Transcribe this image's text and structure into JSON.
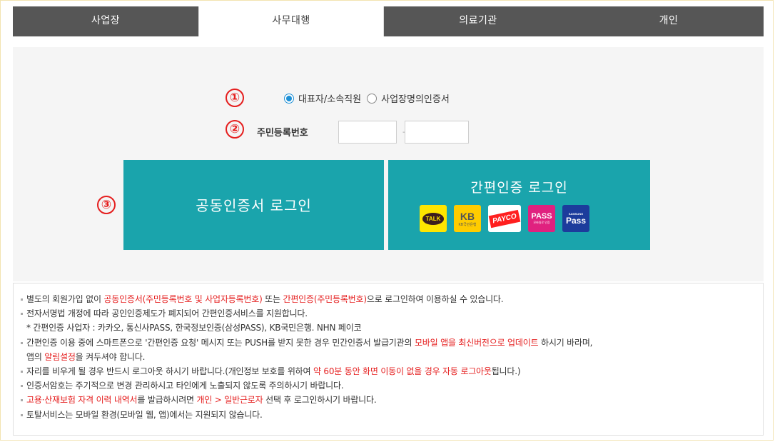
{
  "tabs": [
    {
      "label": "사업장",
      "active": false
    },
    {
      "label": "사무대행",
      "active": true
    },
    {
      "label": "의료기관",
      "active": false
    },
    {
      "label": "개인",
      "active": false
    }
  ],
  "steps": {
    "one": "①",
    "two": "②",
    "three": "③"
  },
  "auth_type": {
    "options": [
      {
        "label": "대표자/소속직원",
        "checked": true
      },
      {
        "label": "사업장명의인증서",
        "checked": false
      }
    ]
  },
  "rrn": {
    "label": "주민등록번호",
    "separator": "-",
    "first_value": "",
    "second_value": ""
  },
  "buttons": {
    "cert_login": "공동인증서 로그인",
    "simple_login": "간편인증 로그인"
  },
  "providers": [
    {
      "name": "kakao-talk",
      "label": "TALK"
    },
    {
      "name": "kb-bank",
      "label": "KB",
      "sub": "KB국민은행"
    },
    {
      "name": "payco",
      "label": "PAYCO"
    },
    {
      "name": "pass",
      "label": "PASS",
      "sub": "모바일로 인증"
    },
    {
      "name": "samsung-pass",
      "label": "Pass",
      "sub": "SAMSUNG"
    }
  ],
  "colors": {
    "accent": "#1aa4ac",
    "tab_bar": "#565656",
    "highlight": "#e51e1e",
    "radio": "#1e90d6"
  },
  "notice": {
    "l1_a": "별도의 회원가입 없이 ",
    "l1_b": "공동인증서(주민등록번호 및 사업자등록번호)",
    "l1_c": " 또는 ",
    "l1_d": "간편인증(주민등록번호)",
    "l1_e": "으로 로그인하여 이용하실 수 있습니다.",
    "l2": "전자서명법 개정에 따라 공인인증제도가 폐지되어 간편인증서비스를 지원합니다.",
    "l3": "* 간편인증 사업자 : 카카오, 통신사PASS, 한국정보인증(삼성PASS), KB국민은행. NHN 페이코",
    "l4_a": "간편인증 이용 중에 스마트폰으로 '간편인증 요청' 메시지 또는 PUSH를 받지 못한 경우 민간인증서 발급기관의 ",
    "l4_b": "모바일 앱을 최신버전으로 업데이트",
    "l4_c": " 하시기 바라며,",
    "l5_a": "앱의 ",
    "l5_b": "알림설정",
    "l5_c": "을 켜두셔야 합니다.",
    "l6_a": "자리를 비우게 될 경우 반드시 로그아웃 하시기 바랍니다.(개인정보 보호를 위하여 ",
    "l6_b": "약 60분 동안 화면 이동이 없을 경우 자동 로그아웃",
    "l6_c": "됩니다.)",
    "l7": "인증서암호는 주기적으로 변경 관리하시고 타인에게 노출되지 않도록 주의하시기 바랍니다.",
    "l8_a": "고용·산재보험 자격 이력 내역서",
    "l8_b": "를 발급하시려면 ",
    "l8_c": "개인 > 일반근로자",
    "l8_d": " 선택 후 로그인하시기 바랍니다.",
    "l9": "토탈서비스는 모바일 환경(모바일 웹, 앱)에서는 지원되지 않습니다."
  }
}
